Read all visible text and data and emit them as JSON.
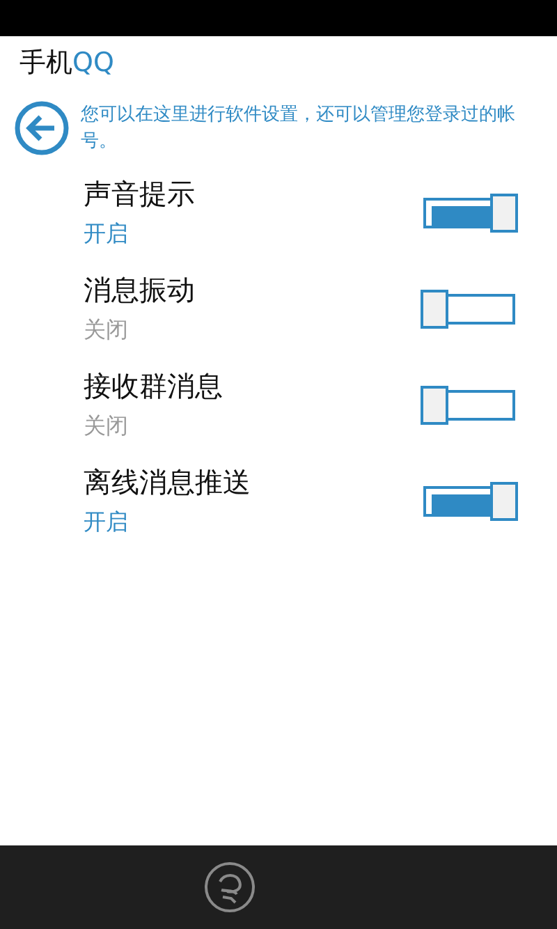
{
  "app_title": {
    "prefix": "手机",
    "brand": "QQ"
  },
  "intro": "您可以在这里进行软件设置，还可以管理您登录过的帐号。",
  "settings": [
    {
      "label": "声音提示",
      "status": "开启",
      "on": true
    },
    {
      "label": "消息振动",
      "status": "关闭",
      "on": false
    },
    {
      "label": "接收群消息",
      "status": "关闭",
      "on": false
    },
    {
      "label": "离线消息推送",
      "status": "开启",
      "on": true
    }
  ]
}
